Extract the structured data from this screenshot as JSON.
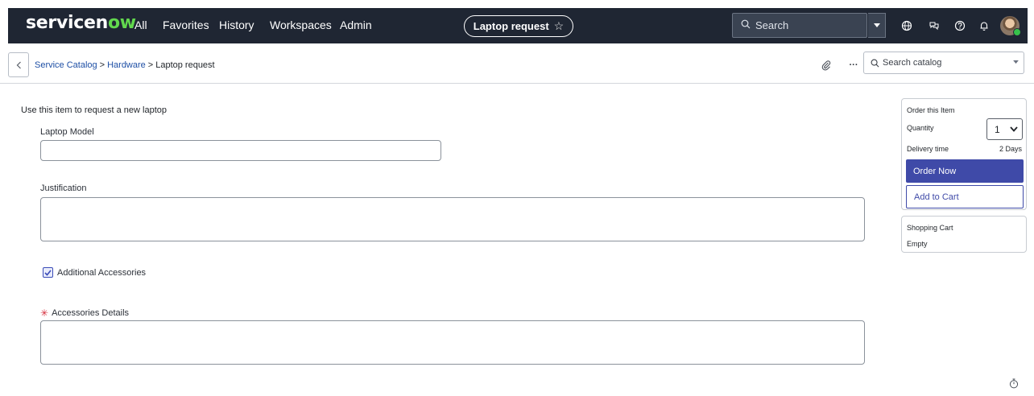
{
  "topbar": {
    "logo_text": "servicen",
    "logo_accent": "ow",
    "nav": [
      "All",
      "Favorites",
      "History",
      "Workspaces",
      "Admin"
    ],
    "pill_label": "Laptop request",
    "pill_star": "☆",
    "search_placeholder": "Search",
    "icons": [
      "globe-icon",
      "chat-icon",
      "help-icon",
      "bell-icon"
    ],
    "bg_color": "#1f2633",
    "logo_accent_color": "#62d84e"
  },
  "subheader": {
    "breadcrumb": {
      "link1": "Service Catalog",
      "sep1": ">",
      "link2": "Hardware",
      "sep2": ">",
      "current": "Laptop request"
    },
    "more_label": "···",
    "catalog_search_placeholder": "Search catalog"
  },
  "form": {
    "intro": "Use this item to request a new laptop",
    "laptop_model_label": "Laptop Model",
    "laptop_model_value": "",
    "justification_label": "Justification",
    "justification_value": "",
    "accessories_checkbox_label": "Additional Accessories",
    "accessories_checked": true,
    "required_marker": "✳",
    "accessories_details_label": "Accessories Details",
    "accessories_details_value": ""
  },
  "order_panel": {
    "title": "Order this Item",
    "quantity_label": "Quantity",
    "quantity_value": "1",
    "delivery_label": "Delivery time",
    "delivery_value": "2 Days",
    "order_now_label": "Order Now",
    "add_to_cart_label": "Add to Cart",
    "accent_color": "#3f4aa8"
  },
  "cart_panel": {
    "title": "Shopping Cart",
    "status": "Empty"
  }
}
